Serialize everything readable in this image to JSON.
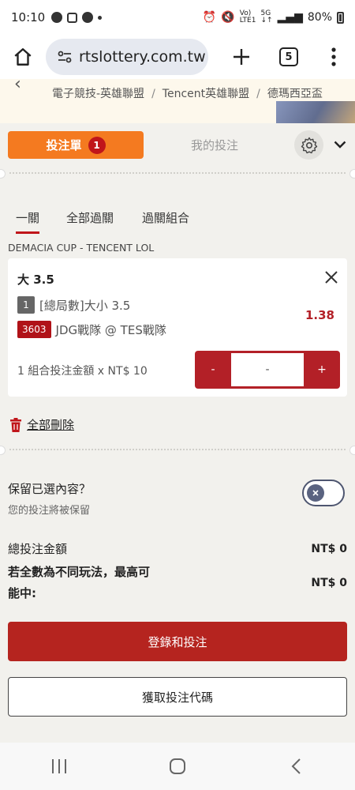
{
  "status_bar": {
    "time": "10:10",
    "battery": "80%",
    "network": "5G"
  },
  "browser": {
    "url": "rtslottery.com.tw",
    "tab_count": "5"
  },
  "background_page": {
    "breadcrumbs": [
      "電子競技-英雄聯盟",
      "Tencent英雄聯盟",
      "德瑪西亞盃"
    ]
  },
  "slip": {
    "tab_betslip": "投注單",
    "tab_betslip_count": "1",
    "tab_mybets": "我的投注",
    "subtabs": [
      "一關",
      "全部過關",
      "過關組合"
    ],
    "league": "DEMACIA CUP - TENCENT LOL",
    "bet": {
      "selection": "大 3.5",
      "market_tag": "1",
      "market": "[總局數]大小 3.5",
      "match_code": "3603",
      "match": "JDG戰隊 @ TES戰隊",
      "odds": "1.38",
      "stake_label": "1 組合投注金額 x NT$ 10",
      "stake_minus": "-",
      "stake_value": "-",
      "stake_plus": "+"
    },
    "delete_all": "全部刪除",
    "retain_title": "保留已選內容？",
    "retain_sub": "您的投注將被保留",
    "total_label": "總投注金額",
    "total_value": "NT$ 0",
    "maxwin_label_1": "若全數為不同玩法，最高可",
    "maxwin_label_2": "能中:",
    "maxwin_value": "NT$ 0",
    "login_button": "登錄和投注",
    "code_button": "獲取投注代碼"
  },
  "colors": {
    "orange": "#f47a20",
    "red": "#b32027",
    "badge": "#c0151a"
  }
}
